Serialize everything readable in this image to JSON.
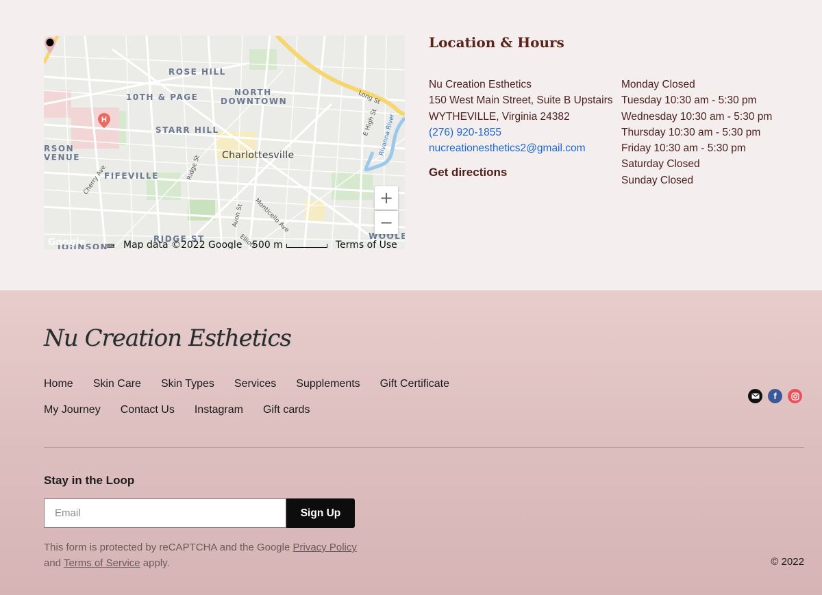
{
  "map": {
    "neighborhoods": [
      "ROSE HILL",
      "10TH & PAGE",
      "NORTH",
      "DOWNTOWN",
      "STARR HILL",
      "FIFEVILLE",
      "RSON",
      "VENUE",
      "RIDGE ST",
      "JOHNSON",
      "WOOLE"
    ],
    "city": "Charlottesville",
    "streets": [
      "Long St",
      "E High St",
      "Rivanna River",
      "Ridge St",
      "Cherry Ave",
      "Avon St",
      "Monticello Ave",
      "Elliott"
    ],
    "zoom_in": "+",
    "zoom_out": "−",
    "google_logo": "Google",
    "attribution": "Map data ©2022 Google",
    "scale": "500 m",
    "terms": "Terms of Use"
  },
  "location": {
    "title": "Location & Hours",
    "business_name": "Nu Creation Esthetics",
    "street": "150 West Main Street, Suite B Upstairs",
    "city_line": "WYTHEVILLE, Virginia 24382",
    "phone": "(276) 920-1855",
    "email": "nucreationesthetics2@gmail.com",
    "directions": "Get directions",
    "link_color": "#1967d2"
  },
  "hours": [
    "Monday Closed",
    "Tuesday 10:30 am - 5:30 pm",
    "Wednesday 10:30 am - 5:30 pm",
    "Thursday 10:30 am - 5:30 pm",
    "Friday 10:30 am - 5:30 pm",
    "Saturday Closed",
    "Sunday Closed"
  ],
  "footer": {
    "logo": "Nu Creation Esthetics",
    "nav_row1": [
      "Home",
      "Skin Care",
      "Skin Types",
      "Services",
      "Supplements",
      "Gift Certificate"
    ],
    "nav_row2": [
      "My Journey",
      "Contact Us",
      "Instagram",
      "Gift cards"
    ],
    "social_icons": [
      "mail-icon",
      "facebook-icon",
      "instagram-icon"
    ],
    "facebook_glyph": "f",
    "newsletter_title": "Stay in the Loop",
    "email_placeholder": "Email",
    "signup_label": "Sign Up",
    "captcha_prefix": "This form is protected by reCAPTCHA and the Google ",
    "privacy_link": "Privacy Policy",
    "captcha_and": " and ",
    "terms_link": "Terms of Service",
    "captcha_suffix": " apply.",
    "copyright": "© 2022",
    "background_top": "#e8cdcd",
    "background_bottom": "#d6b4b5"
  }
}
